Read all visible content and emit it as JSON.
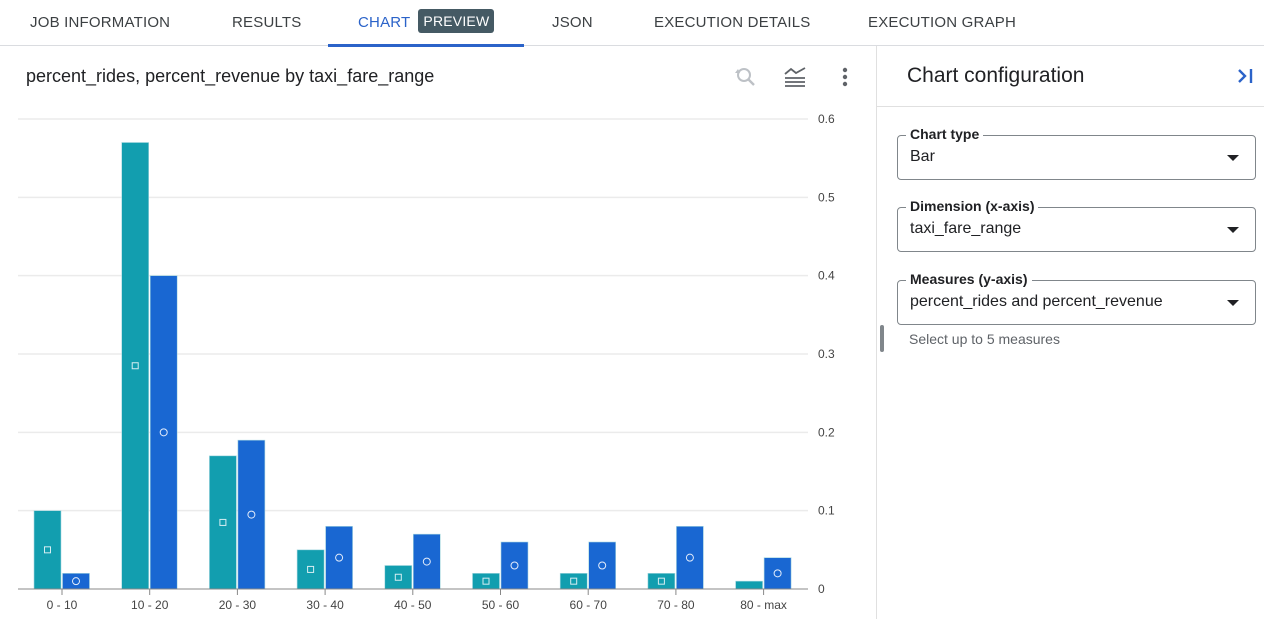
{
  "tabs": [
    {
      "label": "JOB INFORMATION",
      "active": false
    },
    {
      "label": "RESULTS",
      "active": false
    },
    {
      "label": "CHART",
      "active": true,
      "badge": "PREVIEW"
    },
    {
      "label": "JSON",
      "active": false
    },
    {
      "label": "EXECUTION DETAILS",
      "active": false
    },
    {
      "label": "EXECUTION GRAPH",
      "active": false
    }
  ],
  "chart_toolbar": {
    "icons": [
      "reset-zoom-icon",
      "legend-icon",
      "more-vert-icon"
    ]
  },
  "config_panel": {
    "title": "Chart configuration",
    "collapse_icon": "collapse-panel-icon",
    "fields": [
      {
        "label": "Chart type",
        "value": "Bar"
      },
      {
        "label": "Dimension (x-axis)",
        "value": "taxi_fare_range"
      },
      {
        "label": "Measures (y-axis)",
        "value": "percent_rides and percent_revenue"
      }
    ],
    "hint": "Select up to 5 measures"
  },
  "colors": {
    "series_rides": "#129eaf",
    "series_revenue": "#1967d2",
    "active_tab": "#2b63c9",
    "badge_bg": "#455a64"
  },
  "chart_data": {
    "type": "bar",
    "title": "percent_rides, percent_revenue by taxi_fare_range",
    "xlabel": "taxi_fare_range",
    "ylabel": "",
    "categories": [
      "0 - 10",
      "10 - 20",
      "20 - 30",
      "30 - 40",
      "40 - 50",
      "50 - 60",
      "60 - 70",
      "70 - 80",
      "80 - max"
    ],
    "series": [
      {
        "name": "percent_rides",
        "marker": "square",
        "values": [
          0.1,
          0.57,
          0.17,
          0.05,
          0.03,
          0.02,
          0.02,
          0.02,
          0.01
        ]
      },
      {
        "name": "percent_revenue",
        "marker": "circle",
        "values": [
          0.02,
          0.4,
          0.19,
          0.08,
          0.07,
          0.06,
          0.06,
          0.08,
          0.04
        ]
      }
    ],
    "ylim": [
      0,
      0.6
    ],
    "yticks": [
      "0",
      "0.1",
      "0.2",
      "0.3",
      "0.4",
      "0.5",
      "0.6"
    ],
    "ytick_values": [
      0,
      0.1,
      0.2,
      0.3,
      0.4,
      0.5,
      0.6
    ],
    "y_axis_side": "right",
    "grid": true,
    "legend": "none"
  }
}
